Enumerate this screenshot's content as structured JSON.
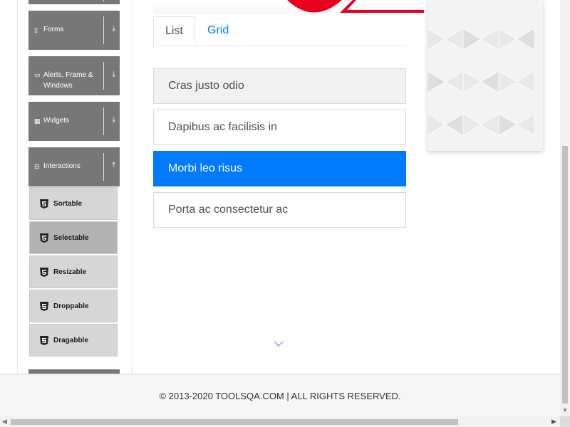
{
  "sidebar": {
    "groups": [
      {
        "label": "Forms",
        "icon": "document-icon",
        "state": "collapsed"
      },
      {
        "label": "Alerts, Frame &\nWindows",
        "icon": "window-icon",
        "state": "collapsed"
      },
      {
        "label": "Widgets",
        "icon": "grid-icon",
        "state": "collapsed"
      },
      {
        "label": "Interactions",
        "icon": "minus-square-icon",
        "state": "expanded"
      }
    ],
    "sub_items": [
      {
        "label": "Sortable",
        "icon": "html5-icon",
        "active": false
      },
      {
        "label": "Selectable",
        "icon": "html5-icon",
        "active": true
      },
      {
        "label": "Resizable",
        "icon": "html5-icon",
        "active": false
      },
      {
        "label": "Droppable",
        "icon": "html5-icon",
        "active": false
      },
      {
        "label": "Dragabble",
        "icon": "html5-icon",
        "active": false
      }
    ],
    "colors": {
      "group_bg": "#777777",
      "sub_bg": "#d6d6d6",
      "sub_active_bg": "#b3b3b3"
    }
  },
  "tabs": [
    {
      "label": "List",
      "active": true
    },
    {
      "label": "Grid",
      "active": false
    }
  ],
  "list_items": [
    {
      "label": "Cras justo odio",
      "state": "hovered"
    },
    {
      "label": "Dapibus ac facilisis in",
      "state": "default"
    },
    {
      "label": "Morbi leo risus",
      "state": "selected"
    },
    {
      "label": "Porta ac consectetur ac",
      "state": "default"
    }
  ],
  "footer": {
    "copyright": "© 2013-2020 TOOLSQA.COM | ALL RIGHTS RESERVED."
  },
  "colors": {
    "accent": "#007bff",
    "selected_bg": "#007bff",
    "hover_bg": "#f1f1f1"
  }
}
